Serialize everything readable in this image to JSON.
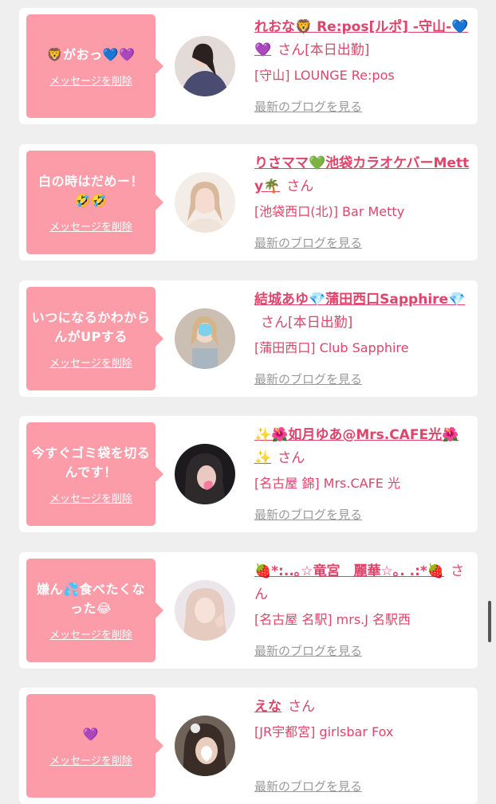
{
  "delete_label": "メッセージを削除",
  "blog_label": "最新のブログを見る",
  "san_label": "さん",
  "items": [
    {
      "message": "🦁がおっ💙💜",
      "name": "れおな🦁 Re:pos[ルポ] -守山-💙💜",
      "status": "[本日出勤]",
      "shop": "[守山] LOUNGE Re:pos",
      "avatar_icon": "avatar-photo-icon"
    },
    {
      "message": "白の時はだめー！🤣🤣",
      "name": "りさママ💚池袋カラオケバーMetty🌴",
      "status": "",
      "shop": "[池袋西口(北)] Bar Metty",
      "avatar_icon": "avatar-photo-icon"
    },
    {
      "message": "いつになるかわからんがUPする",
      "name": "結城あゆ💎蒲田西口Sapphire💎",
      "status": "[本日出勤]",
      "shop": "[蒲田西口] Club Sapphire",
      "avatar_icon": "avatar-photo-icon"
    },
    {
      "message": "今すぐゴミ袋を切るんです！",
      "name": "✨🌺如月ゆあ@Mrs.CAFE光🌺✨",
      "status": "",
      "shop": "[名古屋 錦] Mrs.CAFE 光",
      "avatar_icon": "avatar-photo-icon"
    },
    {
      "message": "嫌ん💦食べたくなった😂",
      "name": "🍓*:..｡☆竜宮　麗華☆｡. .:*🍓",
      "status": "",
      "shop": "[名古屋 名駅] mrs.J 名駅西",
      "avatar_icon": "avatar-photo-icon"
    },
    {
      "message": "💜",
      "name": "えな",
      "status": "",
      "shop": "[JR宇都宮] girlsbar Fox",
      "avatar_icon": "avatar-photo-icon"
    }
  ]
}
